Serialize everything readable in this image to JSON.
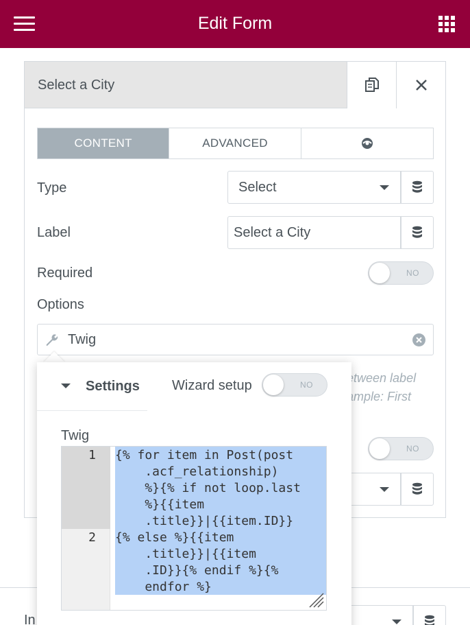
{
  "header": {
    "title": "Edit Form",
    "menu_icon": "hamburger-icon",
    "apps_icon": "grid-icon",
    "background": "#93003a"
  },
  "panel": {
    "title": "Select a City",
    "duplicate_icon": "duplicate-icon",
    "close_icon": "close-icon",
    "tabs": [
      {
        "label": "CONTENT",
        "active": true
      },
      {
        "label": "ADVANCED",
        "active": false
      },
      {
        "label": "",
        "icon": "eye-icon",
        "active": false
      }
    ],
    "type": {
      "label": "Type",
      "value": "Select"
    },
    "field_label": {
      "label": "Label",
      "value": "Select a City"
    },
    "required": {
      "label": "Required",
      "toggle_text": "NO"
    },
    "options": {
      "label": "Options"
    },
    "twig_field": {
      "label": "Twig",
      "icon": "wrench-icon",
      "clear_icon": "clear-icon"
    },
    "hint": {
      "line1": "etween label",
      "line2": "ample: First"
    },
    "second_toggle_text": "NO"
  },
  "lower": {
    "label": "In"
  },
  "popup": {
    "settings_title": "Settings",
    "wizard_label": "Wizard setup",
    "wizard_toggle_text": "NO",
    "twig_label": "Twig",
    "code_lines": [
      {
        "number": "1",
        "wrapped": [
          "{% for item in Post(post",
          "    .acf_relationship)",
          "    %}{% if not loop.last",
          "    %}{{item",
          "    .title}}|{{item.ID}}"
        ]
      },
      {
        "number": "2",
        "wrapped": [
          "{% else %}{{item",
          "    .title}}|{{item",
          "    .ID}}{% endif %}{%",
          "    endfor %}"
        ]
      }
    ],
    "selection_color": "#b5d2f7"
  }
}
